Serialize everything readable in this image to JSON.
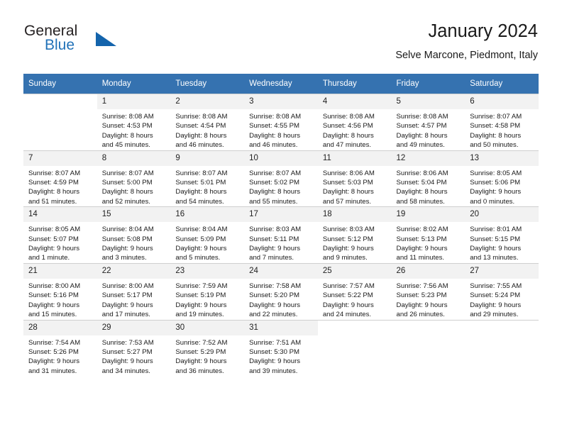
{
  "brand": {
    "line1": "General",
    "line2": "Blue",
    "triangle_icon": "triangle-icon",
    "accent_color": "#1464ac"
  },
  "header": {
    "title": "January 2024",
    "subtitle": "Selve Marcone, Piedmont, Italy"
  },
  "theme": {
    "header_row_bg": "#3572b0",
    "daynum_bg": "#f2f2f2",
    "border": "#cfcfcf"
  },
  "columns": [
    "Sunday",
    "Monday",
    "Tuesday",
    "Wednesday",
    "Thursday",
    "Friday",
    "Saturday"
  ],
  "weeks": [
    [
      {
        "day": "",
        "sunrise": "",
        "sunset": "",
        "daylight1": "",
        "daylight2": ""
      },
      {
        "day": "1",
        "sunrise": "Sunrise: 8:08 AM",
        "sunset": "Sunset: 4:53 PM",
        "daylight1": "Daylight: 8 hours",
        "daylight2": "and 45 minutes."
      },
      {
        "day": "2",
        "sunrise": "Sunrise: 8:08 AM",
        "sunset": "Sunset: 4:54 PM",
        "daylight1": "Daylight: 8 hours",
        "daylight2": "and 46 minutes."
      },
      {
        "day": "3",
        "sunrise": "Sunrise: 8:08 AM",
        "sunset": "Sunset: 4:55 PM",
        "daylight1": "Daylight: 8 hours",
        "daylight2": "and 46 minutes."
      },
      {
        "day": "4",
        "sunrise": "Sunrise: 8:08 AM",
        "sunset": "Sunset: 4:56 PM",
        "daylight1": "Daylight: 8 hours",
        "daylight2": "and 47 minutes."
      },
      {
        "day": "5",
        "sunrise": "Sunrise: 8:08 AM",
        "sunset": "Sunset: 4:57 PM",
        "daylight1": "Daylight: 8 hours",
        "daylight2": "and 49 minutes."
      },
      {
        "day": "6",
        "sunrise": "Sunrise: 8:07 AM",
        "sunset": "Sunset: 4:58 PM",
        "daylight1": "Daylight: 8 hours",
        "daylight2": "and 50 minutes."
      }
    ],
    [
      {
        "day": "7",
        "sunrise": "Sunrise: 8:07 AM",
        "sunset": "Sunset: 4:59 PM",
        "daylight1": "Daylight: 8 hours",
        "daylight2": "and 51 minutes."
      },
      {
        "day": "8",
        "sunrise": "Sunrise: 8:07 AM",
        "sunset": "Sunset: 5:00 PM",
        "daylight1": "Daylight: 8 hours",
        "daylight2": "and 52 minutes."
      },
      {
        "day": "9",
        "sunrise": "Sunrise: 8:07 AM",
        "sunset": "Sunset: 5:01 PM",
        "daylight1": "Daylight: 8 hours",
        "daylight2": "and 54 minutes."
      },
      {
        "day": "10",
        "sunrise": "Sunrise: 8:07 AM",
        "sunset": "Sunset: 5:02 PM",
        "daylight1": "Daylight: 8 hours",
        "daylight2": "and 55 minutes."
      },
      {
        "day": "11",
        "sunrise": "Sunrise: 8:06 AM",
        "sunset": "Sunset: 5:03 PM",
        "daylight1": "Daylight: 8 hours",
        "daylight2": "and 57 minutes."
      },
      {
        "day": "12",
        "sunrise": "Sunrise: 8:06 AM",
        "sunset": "Sunset: 5:04 PM",
        "daylight1": "Daylight: 8 hours",
        "daylight2": "and 58 minutes."
      },
      {
        "day": "13",
        "sunrise": "Sunrise: 8:05 AM",
        "sunset": "Sunset: 5:06 PM",
        "daylight1": "Daylight: 9 hours",
        "daylight2": "and 0 minutes."
      }
    ],
    [
      {
        "day": "14",
        "sunrise": "Sunrise: 8:05 AM",
        "sunset": "Sunset: 5:07 PM",
        "daylight1": "Daylight: 9 hours",
        "daylight2": "and 1 minute."
      },
      {
        "day": "15",
        "sunrise": "Sunrise: 8:04 AM",
        "sunset": "Sunset: 5:08 PM",
        "daylight1": "Daylight: 9 hours",
        "daylight2": "and 3 minutes."
      },
      {
        "day": "16",
        "sunrise": "Sunrise: 8:04 AM",
        "sunset": "Sunset: 5:09 PM",
        "daylight1": "Daylight: 9 hours",
        "daylight2": "and 5 minutes."
      },
      {
        "day": "17",
        "sunrise": "Sunrise: 8:03 AM",
        "sunset": "Sunset: 5:11 PM",
        "daylight1": "Daylight: 9 hours",
        "daylight2": "and 7 minutes."
      },
      {
        "day": "18",
        "sunrise": "Sunrise: 8:03 AM",
        "sunset": "Sunset: 5:12 PM",
        "daylight1": "Daylight: 9 hours",
        "daylight2": "and 9 minutes."
      },
      {
        "day": "19",
        "sunrise": "Sunrise: 8:02 AM",
        "sunset": "Sunset: 5:13 PM",
        "daylight1": "Daylight: 9 hours",
        "daylight2": "and 11 minutes."
      },
      {
        "day": "20",
        "sunrise": "Sunrise: 8:01 AM",
        "sunset": "Sunset: 5:15 PM",
        "daylight1": "Daylight: 9 hours",
        "daylight2": "and 13 minutes."
      }
    ],
    [
      {
        "day": "21",
        "sunrise": "Sunrise: 8:00 AM",
        "sunset": "Sunset: 5:16 PM",
        "daylight1": "Daylight: 9 hours",
        "daylight2": "and 15 minutes."
      },
      {
        "day": "22",
        "sunrise": "Sunrise: 8:00 AM",
        "sunset": "Sunset: 5:17 PM",
        "daylight1": "Daylight: 9 hours",
        "daylight2": "and 17 minutes."
      },
      {
        "day": "23",
        "sunrise": "Sunrise: 7:59 AM",
        "sunset": "Sunset: 5:19 PM",
        "daylight1": "Daylight: 9 hours",
        "daylight2": "and 19 minutes."
      },
      {
        "day": "24",
        "sunrise": "Sunrise: 7:58 AM",
        "sunset": "Sunset: 5:20 PM",
        "daylight1": "Daylight: 9 hours",
        "daylight2": "and 22 minutes."
      },
      {
        "day": "25",
        "sunrise": "Sunrise: 7:57 AM",
        "sunset": "Sunset: 5:22 PM",
        "daylight1": "Daylight: 9 hours",
        "daylight2": "and 24 minutes."
      },
      {
        "day": "26",
        "sunrise": "Sunrise: 7:56 AM",
        "sunset": "Sunset: 5:23 PM",
        "daylight1": "Daylight: 9 hours",
        "daylight2": "and 26 minutes."
      },
      {
        "day": "27",
        "sunrise": "Sunrise: 7:55 AM",
        "sunset": "Sunset: 5:24 PM",
        "daylight1": "Daylight: 9 hours",
        "daylight2": "and 29 minutes."
      }
    ],
    [
      {
        "day": "28",
        "sunrise": "Sunrise: 7:54 AM",
        "sunset": "Sunset: 5:26 PM",
        "daylight1": "Daylight: 9 hours",
        "daylight2": "and 31 minutes."
      },
      {
        "day": "29",
        "sunrise": "Sunrise: 7:53 AM",
        "sunset": "Sunset: 5:27 PM",
        "daylight1": "Daylight: 9 hours",
        "daylight2": "and 34 minutes."
      },
      {
        "day": "30",
        "sunrise": "Sunrise: 7:52 AM",
        "sunset": "Sunset: 5:29 PM",
        "daylight1": "Daylight: 9 hours",
        "daylight2": "and 36 minutes."
      },
      {
        "day": "31",
        "sunrise": "Sunrise: 7:51 AM",
        "sunset": "Sunset: 5:30 PM",
        "daylight1": "Daylight: 9 hours",
        "daylight2": "and 39 minutes."
      },
      {
        "day": "",
        "sunrise": "",
        "sunset": "",
        "daylight1": "",
        "daylight2": ""
      },
      {
        "day": "",
        "sunrise": "",
        "sunset": "",
        "daylight1": "",
        "daylight2": ""
      },
      {
        "day": "",
        "sunrise": "",
        "sunset": "",
        "daylight1": "",
        "daylight2": ""
      }
    ]
  ]
}
